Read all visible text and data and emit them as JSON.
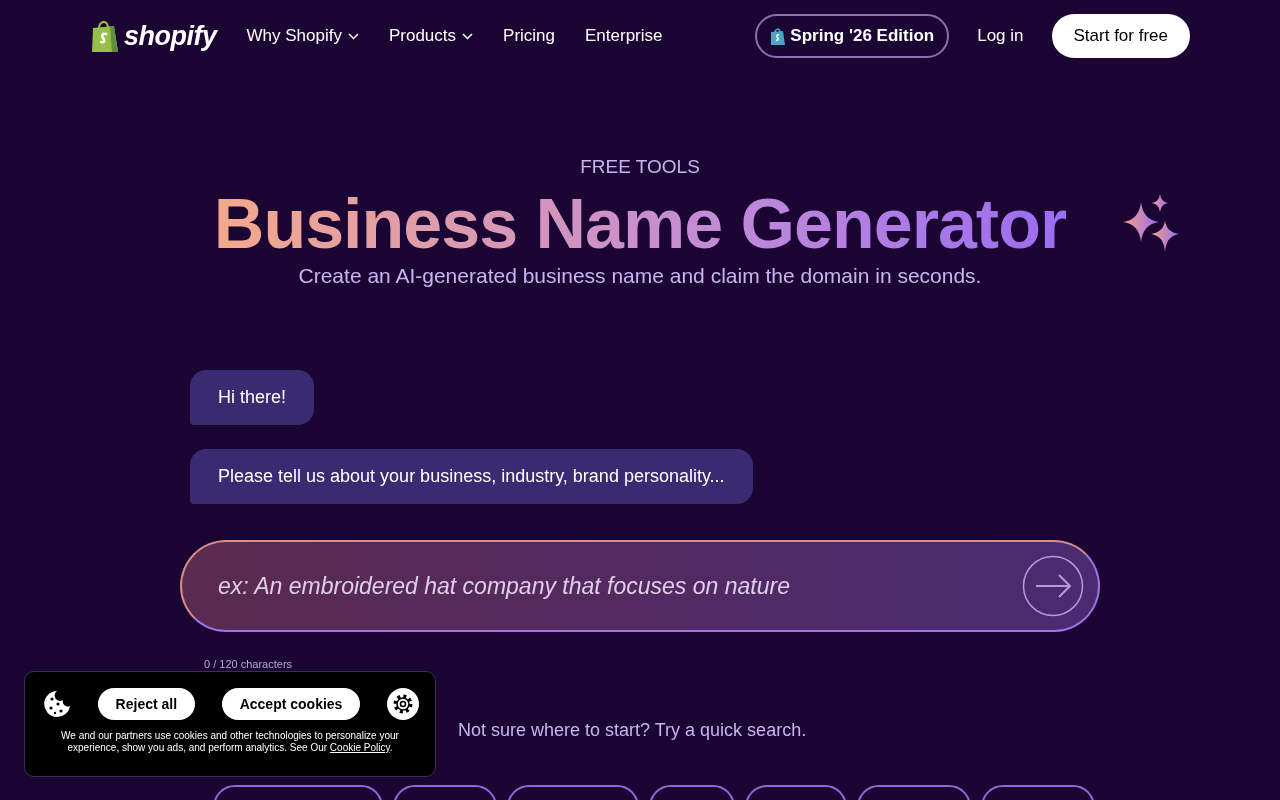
{
  "header": {
    "logo": "shopify",
    "nav": [
      {
        "label": "Why Shopify",
        "dropdown": true
      },
      {
        "label": "Products",
        "dropdown": true
      },
      {
        "label": "Pricing",
        "dropdown": false
      },
      {
        "label": "Enterprise",
        "dropdown": false
      }
    ],
    "edition": "Spring '26 Edition",
    "login": "Log in",
    "cta": "Start for free"
  },
  "hero": {
    "eyebrow": "FREE TOOLS",
    "title": "Business Name Generator",
    "subtitle": "Create an AI-generated business name and claim the domain in seconds."
  },
  "chat": {
    "messages": [
      "Hi there!",
      "Please tell us about your business, industry, brand personality..."
    ],
    "input": {
      "placeholder": "ex: An embroidered hat company that focuses on nature",
      "counter": "0 / 120 characters"
    }
  },
  "quick_search": {
    "prompt": "Not sure where to start? Try a quick search."
  },
  "cookie_banner": {
    "reject": "Reject all",
    "accept": "Accept cookies",
    "text": "We and our partners use cookies and other technologies to personalize your experience, show you ads, and perform analytics. See Our",
    "link": "Cookie Policy",
    "end": "."
  }
}
